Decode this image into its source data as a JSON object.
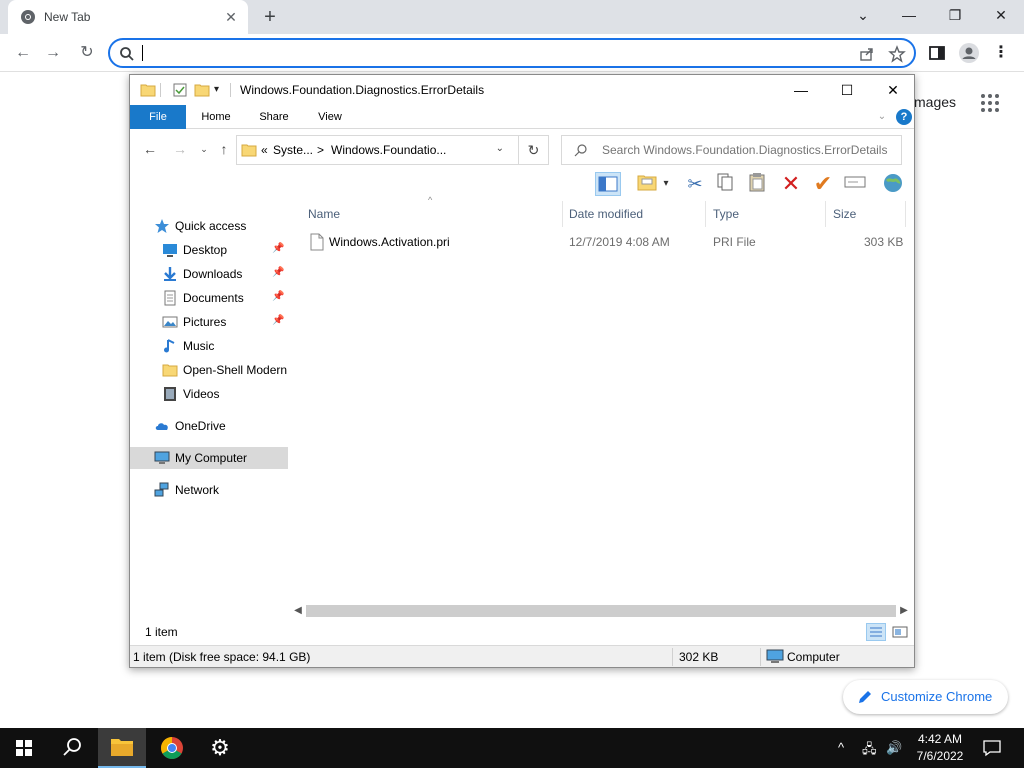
{
  "chrome": {
    "tab_title": "New Tab",
    "omnibox_value": "",
    "ntp_images_label": "mages",
    "customize_label": "Customize Chrome"
  },
  "explorer": {
    "title": "Windows.Foundation.Diagnostics.ErrorDetails",
    "ribbon_tabs": [
      "File",
      "Home",
      "Share",
      "View"
    ],
    "address_segments": [
      "«",
      "Syste...",
      ">",
      "Windows.Foundatio..."
    ],
    "search_placeholder": "Search Windows.Foundation.Diagnostics.ErrorDetails",
    "sidebar": [
      {
        "label": "Quick access",
        "icon": "star-icon",
        "pinned": false
      },
      {
        "label": "Desktop",
        "icon": "desktop-icon",
        "pinned": true
      },
      {
        "label": "Downloads",
        "icon": "download-icon",
        "pinned": true
      },
      {
        "label": "Documents",
        "icon": "document-icon",
        "pinned": true
      },
      {
        "label": "Pictures",
        "icon": "picture-icon",
        "pinned": true
      },
      {
        "label": "Music",
        "icon": "music-icon",
        "pinned": false
      },
      {
        "label": "Open-Shell Modern",
        "icon": "folder-icon",
        "pinned": false
      },
      {
        "label": "Videos",
        "icon": "video-icon",
        "pinned": false
      },
      {
        "label": "OneDrive",
        "icon": "cloud-icon",
        "pinned": false
      },
      {
        "label": "My Computer",
        "icon": "computer-icon",
        "pinned": false,
        "selected": true
      },
      {
        "label": "Network",
        "icon": "network-icon",
        "pinned": false
      }
    ],
    "columns": [
      "Name",
      "Date modified",
      "Type",
      "Size"
    ],
    "files": [
      {
        "name": "Windows.Activation.pri",
        "date": "12/7/2019 4:08 AM",
        "type": "PRI File",
        "size": "303 KB"
      }
    ],
    "item_count": "1 item",
    "status_disk": "1 item (Disk free space: 94.1 GB)",
    "status_size": "302 KB",
    "status_location": "Computer"
  },
  "taskbar": {
    "time": "4:42 AM",
    "date": "7/6/2022"
  },
  "colors": {
    "accent": "#1a73e8",
    "file_tab": "#1979ca",
    "taskbar": "#101010"
  }
}
